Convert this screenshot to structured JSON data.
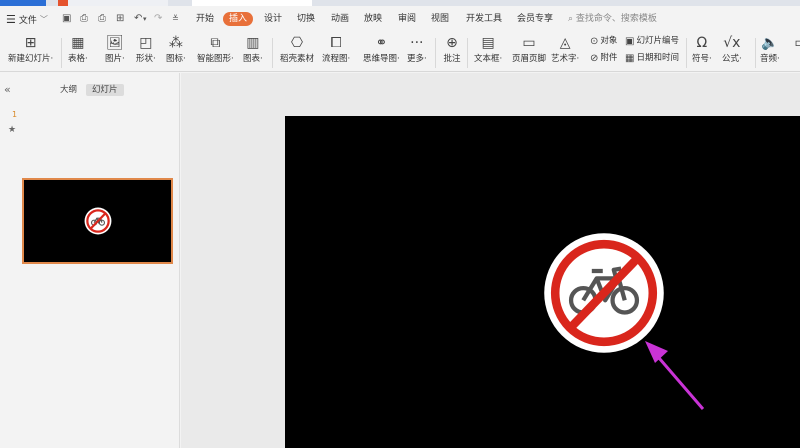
{
  "menubar": {
    "file_label": "文件",
    "tabs": [
      {
        "label": "开始"
      },
      {
        "label": "插入"
      },
      {
        "label": "设计"
      },
      {
        "label": "切换"
      },
      {
        "label": "动画"
      },
      {
        "label": "放映"
      },
      {
        "label": "审阅"
      },
      {
        "label": "视图"
      },
      {
        "label": "开发工具"
      },
      {
        "label": "会员专享"
      }
    ],
    "active_tab": "插入",
    "search_placeholder": "查找命令、搜索模板"
  },
  "ribbon": {
    "items": [
      {
        "label": "新建幻灯片·",
        "icon": "new-slide-icon"
      },
      {
        "label": "表格·",
        "icon": "table-icon"
      },
      {
        "label": "图片·",
        "icon": "picture-icon"
      },
      {
        "label": "形状·",
        "icon": "shape-icon"
      },
      {
        "label": "图标·",
        "icon": "icon-library-icon"
      },
      {
        "label": "智能图形·",
        "icon": "smartart-icon"
      },
      {
        "label": "图表·",
        "icon": "chart-icon"
      },
      {
        "label": "稻壳素材",
        "icon": "docer-material-icon"
      },
      {
        "label": "流程图·",
        "icon": "flowchart-icon"
      },
      {
        "label": "思维导图·",
        "icon": "mindmap-icon"
      },
      {
        "label": "更多·",
        "icon": "more-icon"
      },
      {
        "label": "批注",
        "icon": "comment-icon"
      },
      {
        "label": "文本框·",
        "icon": "textbox-icon"
      },
      {
        "label": "页眉页脚",
        "icon": "header-footer-icon"
      },
      {
        "label": "艺术字·",
        "icon": "wordart-icon"
      },
      {
        "label": "符号·",
        "icon": "symbol-icon"
      },
      {
        "label": "公式·",
        "icon": "formula-icon"
      },
      {
        "label": "音频·",
        "icon": "audio-icon"
      }
    ],
    "small_items": [
      {
        "label": "对象",
        "icon": "object-icon"
      },
      {
        "label": "附件",
        "icon": "attachment-icon"
      },
      {
        "label": "幻灯片编号",
        "icon": "slide-number-icon"
      },
      {
        "label": "日期和时间",
        "icon": "date-time-icon"
      }
    ]
  },
  "leftpane": {
    "tabs": [
      {
        "label": "大纲"
      },
      {
        "label": "幻灯片"
      }
    ],
    "active_tab": "幻灯片",
    "slides": [
      {
        "number": "1"
      }
    ]
  },
  "colors": {
    "accent": "#e8703a",
    "slide_bg": "#000000",
    "no_bike_red": "#d9261c",
    "arrow": "#c933d6"
  }
}
